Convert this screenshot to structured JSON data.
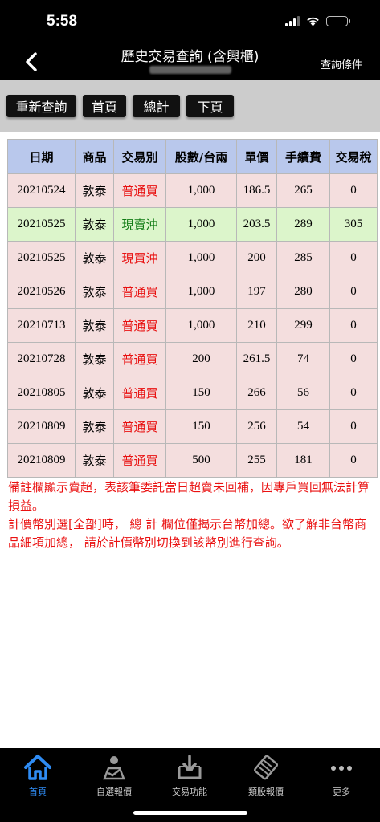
{
  "status_bar": {
    "time": "5:58"
  },
  "nav": {
    "title": "歷史交易查詢 (含興櫃)",
    "query_label": "查詢條件"
  },
  "toolbar": {
    "requery": "重新查詢",
    "first_page": "首頁",
    "total": "總計",
    "next_page": "下頁"
  },
  "table": {
    "headers": [
      "日期",
      "商品",
      "交易別",
      "股數/台兩",
      "單價",
      "手續費",
      "交易稅"
    ],
    "rows": [
      {
        "date": "20210524",
        "product": "敦泰",
        "type": "普通買",
        "shares": "1,000",
        "price": "186.5",
        "fee": "265",
        "tax": "0"
      },
      {
        "date": "20210525",
        "product": "敦泰",
        "type": "現賣沖",
        "shares": "1,000",
        "price": "203.5",
        "fee": "289",
        "tax": "305"
      },
      {
        "date": "20210525",
        "product": "敦泰",
        "type": "現買沖",
        "shares": "1,000",
        "price": "200",
        "fee": "285",
        "tax": "0"
      },
      {
        "date": "20210526",
        "product": "敦泰",
        "type": "普通買",
        "shares": "1,000",
        "price": "197",
        "fee": "280",
        "tax": "0"
      },
      {
        "date": "20210713",
        "product": "敦泰",
        "type": "普通買",
        "shares": "1,000",
        "price": "210",
        "fee": "299",
        "tax": "0"
      },
      {
        "date": "20210728",
        "product": "敦泰",
        "type": "普通買",
        "shares": "200",
        "price": "261.5",
        "fee": "74",
        "tax": "0"
      },
      {
        "date": "20210805",
        "product": "敦泰",
        "type": "普通買",
        "shares": "150",
        "price": "266",
        "fee": "56",
        "tax": "0"
      },
      {
        "date": "20210809",
        "product": "敦泰",
        "type": "普通買",
        "shares": "150",
        "price": "256",
        "fee": "54",
        "tax": "0"
      },
      {
        "date": "20210809",
        "product": "敦泰",
        "type": "普通買",
        "shares": "500",
        "price": "255",
        "fee": "181",
        "tax": "0"
      }
    ]
  },
  "notes": {
    "line1": "備註欄顯示賣超，表該筆委託當日超賣未回補，因專戶買回無法計算損益。",
    "line2": "計價幣別選[全部]時， 總 計 欄位僅揭示台幣加總。欲了解非台幣商品細項加總， 請於計價幣別切換到該幣別進行查詢。"
  },
  "tabs": [
    {
      "label": "首頁",
      "icon": "home-icon",
      "active": true
    },
    {
      "label": "自選報價",
      "icon": "watchlist-icon",
      "active": false
    },
    {
      "label": "交易功能",
      "icon": "trade-icon",
      "active": false
    },
    {
      "label": "類股報價",
      "icon": "sector-icon",
      "active": false
    },
    {
      "label": "更多",
      "icon": "more-icon",
      "active": false
    }
  ],
  "colors": {
    "header_bg": "#b9c8ec",
    "row_pink": "#f4dede",
    "row_green": "#dcf5cb",
    "buy_text": "#e81010",
    "sell_text": "#0e7a12",
    "note_text": "#ea1111",
    "active_tab": "#2f8cf4"
  }
}
